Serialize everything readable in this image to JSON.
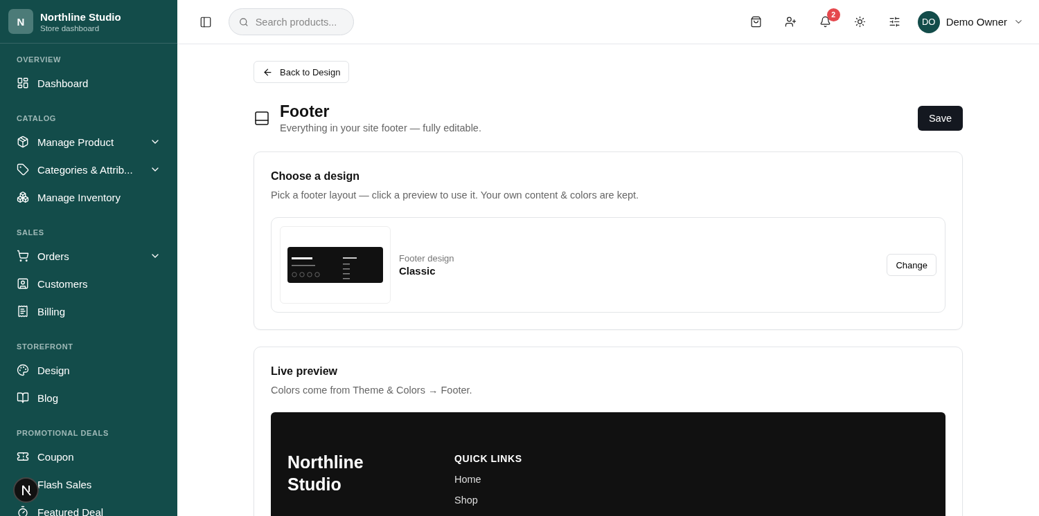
{
  "brand": {
    "initial": "N",
    "name": "Northline Studio",
    "subtitle": "Store dashboard"
  },
  "sidebar": {
    "sections": [
      {
        "title": "OVERVIEW",
        "items": [
          {
            "label": "Dashboard",
            "has_submenu": false
          }
        ]
      },
      {
        "title": "CATALOG",
        "items": [
          {
            "label": "Manage Product",
            "has_submenu": true
          },
          {
            "label": "Categories & Attrib...",
            "has_submenu": true
          },
          {
            "label": "Manage Inventory",
            "has_submenu": false
          }
        ]
      },
      {
        "title": "SALES",
        "items": [
          {
            "label": "Orders",
            "has_submenu": true
          },
          {
            "label": "Customers",
            "has_submenu": false
          },
          {
            "label": "Billing",
            "has_submenu": false
          }
        ]
      },
      {
        "title": "STOREFRONT",
        "items": [
          {
            "label": "Design",
            "has_submenu": false
          },
          {
            "label": "Blog",
            "has_submenu": false
          }
        ]
      },
      {
        "title": "PROMOTIONAL DEALS",
        "items": [
          {
            "label": "Coupon",
            "has_submenu": false
          },
          {
            "label": "Flash Sales",
            "has_submenu": false
          },
          {
            "label": "Featured Deal",
            "has_submenu": false
          }
        ]
      }
    ]
  },
  "topbar": {
    "search": {
      "placeholder": "Search products..."
    },
    "notifications": "2",
    "user": {
      "initials": "DO",
      "name": "Demo Owner"
    }
  },
  "page": {
    "back": "Back to Design",
    "title": "Footer",
    "subtitle": "Everything in your site footer — fully editable.",
    "save": "Save"
  },
  "design_card": {
    "title": "Choose a design",
    "description": "Pick a footer layout — click a preview to use it. Your own content & colors are kept.",
    "label": "Footer design",
    "value": "Classic",
    "change": "Change"
  },
  "preview_card": {
    "title": "Live preview",
    "description": "Colors come from Theme & Colors → Footer.",
    "footer": {
      "brand": "Northline Studio",
      "heading": "QUICK LINKS",
      "links": [
        "Home",
        "Shop"
      ]
    }
  }
}
